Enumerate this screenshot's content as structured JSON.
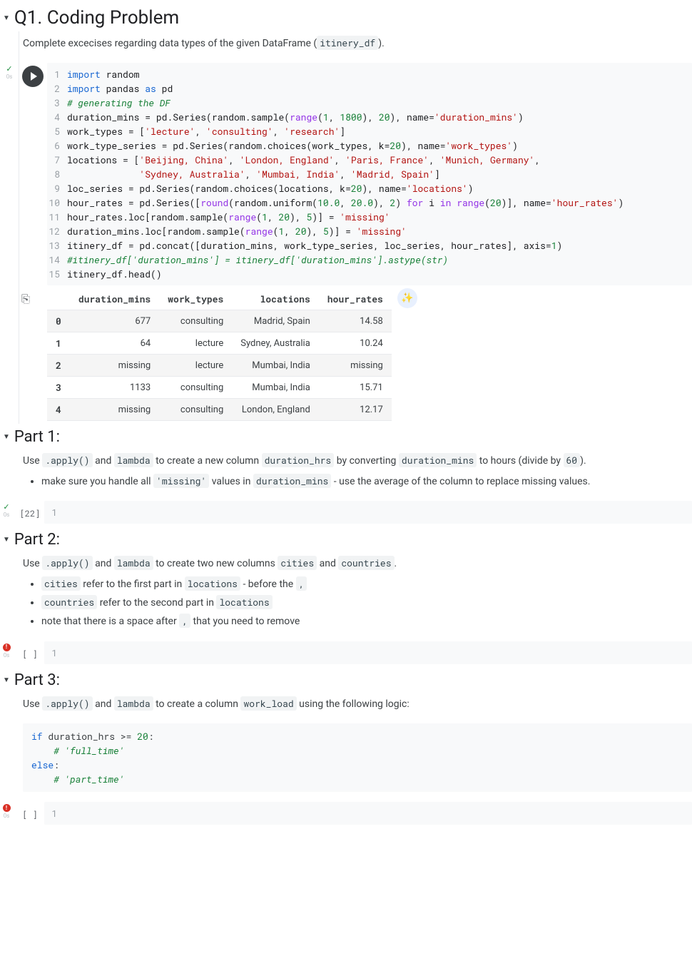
{
  "q1": {
    "title": "Q1. Coding Problem",
    "desc_pre": "Complete excecises regarding data types of the given DataFrame (",
    "desc_code": "itinery_df",
    "desc_post": ").",
    "status_dur": "0s",
    "code_lines": [
      [
        [
          "import",
          "kw"
        ],
        [
          " random",
          ""
        ]
      ],
      [
        [
          "import",
          "kw"
        ],
        [
          " pandas ",
          ""
        ],
        [
          "as",
          "kw"
        ],
        [
          " pd",
          ""
        ]
      ],
      [
        [
          "# generating the DF",
          "com"
        ]
      ],
      [
        [
          "duration_mins = pd.Series(random.sample(",
          ""
        ],
        [
          "range",
          "bltn"
        ],
        [
          "(",
          ""
        ],
        [
          "1",
          "num"
        ],
        [
          ", ",
          ""
        ],
        [
          "1800",
          "num"
        ],
        [
          "), ",
          ""
        ],
        [
          "20",
          "num"
        ],
        [
          "), name=",
          ""
        ],
        [
          "'duration_mins'",
          "str"
        ],
        [
          ")",
          ""
        ]
      ],
      [
        [
          "work_types = [",
          ""
        ],
        [
          "'lecture'",
          "str"
        ],
        [
          ", ",
          ""
        ],
        [
          "'consulting'",
          "str"
        ],
        [
          ", ",
          ""
        ],
        [
          "'research'",
          "str"
        ],
        [
          "]",
          ""
        ]
      ],
      [
        [
          "work_type_series = pd.Series(random.choices(work_types, k=",
          ""
        ],
        [
          "20",
          "num"
        ],
        [
          "), name=",
          ""
        ],
        [
          "'work_types'",
          "str"
        ],
        [
          ")",
          ""
        ]
      ],
      [
        [
          "locations = [",
          ""
        ],
        [
          "'Beijing, China'",
          "str"
        ],
        [
          ", ",
          ""
        ],
        [
          "'London, England'",
          "str"
        ],
        [
          ", ",
          ""
        ],
        [
          "'Paris, France'",
          "str"
        ],
        [
          ", ",
          ""
        ],
        [
          "'Munich, Germany'",
          "str"
        ],
        [
          ",",
          ""
        ]
      ],
      [
        [
          "             ",
          ""
        ],
        [
          "'Sydney, Australia'",
          "str"
        ],
        [
          ", ",
          ""
        ],
        [
          "'Mumbai, India'",
          "str"
        ],
        [
          ", ",
          ""
        ],
        [
          "'Madrid, Spain'",
          "str"
        ],
        [
          "]",
          ""
        ]
      ],
      [
        [
          "loc_series = pd.Series(random.choices(locations, k=",
          ""
        ],
        [
          "20",
          "num"
        ],
        [
          "), name=",
          ""
        ],
        [
          "'locations'",
          "str"
        ],
        [
          ")",
          ""
        ]
      ],
      [
        [
          "hour_rates = pd.Series([",
          ""
        ],
        [
          "round",
          "bltn"
        ],
        [
          "(random.uniform(",
          ""
        ],
        [
          "10.0",
          "num"
        ],
        [
          ", ",
          ""
        ],
        [
          "20.0",
          "num"
        ],
        [
          "), ",
          ""
        ],
        [
          "2",
          "num"
        ],
        [
          ") ",
          ""
        ],
        [
          "for",
          "kw2"
        ],
        [
          " i ",
          ""
        ],
        [
          "in",
          "kw2"
        ],
        [
          " ",
          ""
        ],
        [
          "range",
          "bltn"
        ],
        [
          "(",
          ""
        ],
        [
          "20",
          "num"
        ],
        [
          ")], name=",
          ""
        ],
        [
          "'hour_rates'",
          "str"
        ],
        [
          ")",
          ""
        ]
      ],
      [
        [
          "hour_rates.loc[random.sample(",
          ""
        ],
        [
          "range",
          "bltn"
        ],
        [
          "(",
          ""
        ],
        [
          "1",
          "num"
        ],
        [
          ", ",
          ""
        ],
        [
          "20",
          "num"
        ],
        [
          "), ",
          ""
        ],
        [
          "5",
          "num"
        ],
        [
          ")] = ",
          ""
        ],
        [
          "'missing'",
          "str"
        ]
      ],
      [
        [
          "duration_mins.loc[random.sample(",
          ""
        ],
        [
          "range",
          "bltn"
        ],
        [
          "(",
          ""
        ],
        [
          "1",
          "num"
        ],
        [
          ", ",
          ""
        ],
        [
          "20",
          "num"
        ],
        [
          "), ",
          ""
        ],
        [
          "5",
          "num"
        ],
        [
          ")] = ",
          ""
        ],
        [
          "'missing'",
          "str"
        ]
      ],
      [
        [
          "itinery_df = pd.concat([duration_mins, work_type_series, loc_series, hour_rates], axis=",
          ""
        ],
        [
          "1",
          "num"
        ],
        [
          ")",
          ""
        ]
      ],
      [
        [
          "#itinery_df['duration_mins'] = itinery_df['duration_mins'].astype(str)",
          "com"
        ]
      ],
      [
        [
          "itinery_df.head()",
          ""
        ]
      ]
    ],
    "df_headers": [
      "",
      "duration_mins",
      "work_types",
      "locations",
      "hour_rates"
    ],
    "df_rows": [
      [
        "0",
        "677",
        "consulting",
        "Madrid, Spain",
        "14.58"
      ],
      [
        "1",
        "64",
        "lecture",
        "Sydney, Australia",
        "10.24"
      ],
      [
        "2",
        "missing",
        "lecture",
        "Mumbai, India",
        "missing"
      ],
      [
        "3",
        "1133",
        "consulting",
        "Mumbai, India",
        "15.71"
      ],
      [
        "4",
        "missing",
        "consulting",
        "London, England",
        "12.17"
      ]
    ]
  },
  "part1": {
    "title": "Part 1:",
    "p_tokens": [
      "Use ",
      [
        "code",
        ".apply()"
      ],
      " and ",
      [
        "code",
        "lambda"
      ],
      " to create a new column ",
      [
        "code",
        "duration_hrs"
      ],
      " by converting ",
      [
        "code",
        "duration_mins"
      ],
      " to hours (divide by ",
      [
        "code",
        "60"
      ],
      ")."
    ],
    "bullet_tokens": [
      "make sure you handle all ",
      [
        "code",
        "'missing'"
      ],
      " values in ",
      [
        "code",
        "duration_mins"
      ],
      " - use the average of the column to replace missing values."
    ],
    "exec_label": "[22]",
    "exec_dur": "0s",
    "code_line": "1"
  },
  "part2": {
    "title": "Part 2:",
    "p_tokens": [
      "Use ",
      [
        "code",
        ".apply()"
      ],
      " and ",
      [
        "code",
        "lambda"
      ],
      " to create two new columns ",
      [
        "code",
        "cities"
      ],
      " and ",
      [
        "code",
        "countries"
      ],
      "."
    ],
    "bullets": [
      [
        [
          "code",
          "cities"
        ],
        " refer to the first part in ",
        [
          "code",
          "locations"
        ],
        " - before the ",
        [
          "code",
          ","
        ]
      ],
      [
        [
          "code",
          "countries"
        ],
        " refer to the second part in ",
        [
          "code",
          "locations"
        ]
      ],
      [
        "note that there is a space after ",
        [
          "code",
          ","
        ],
        " that you need to remove"
      ]
    ],
    "exec_label": "[ ]",
    "exec_dur": "0s",
    "code_line": "1"
  },
  "part3": {
    "title": "Part 3:",
    "p_tokens": [
      "Use ",
      [
        "code",
        ".apply()"
      ],
      " and ",
      [
        "code",
        "lambda"
      ],
      " to create a column ",
      [
        "code",
        "work_load"
      ],
      " using the following logic:"
    ],
    "codeblock": [
      [
        [
          "if",
          "kw"
        ],
        [
          " duration_hrs >= ",
          ""
        ],
        [
          "20",
          "num"
        ],
        [
          ":",
          ""
        ]
      ],
      [
        [
          "    ",
          ""
        ],
        [
          "# 'full_time'",
          "com"
        ]
      ],
      [
        [
          "else",
          "kw"
        ],
        [
          ":",
          ""
        ]
      ],
      [
        [
          "    ",
          ""
        ],
        [
          "# 'part_time'",
          "com"
        ]
      ]
    ],
    "exec_label": "[ ]",
    "exec_dur": "0s",
    "code_line": "1"
  }
}
